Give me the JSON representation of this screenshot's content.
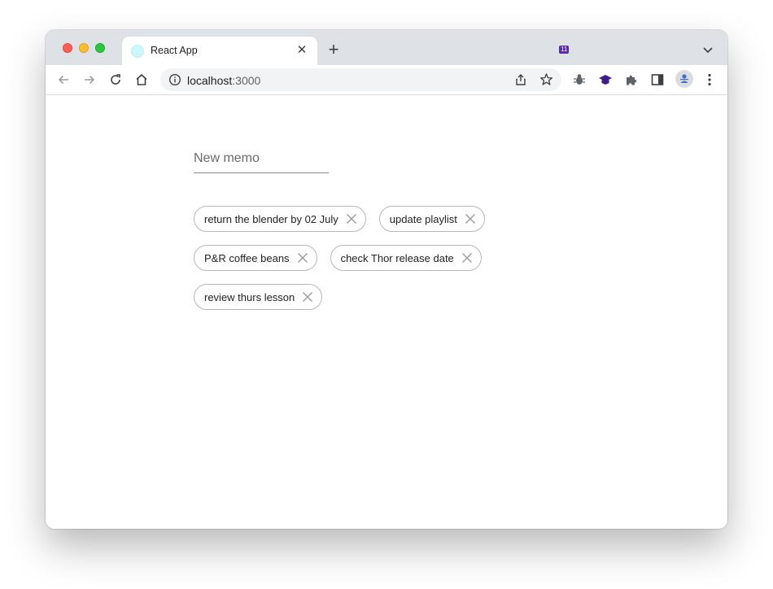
{
  "browser": {
    "tab_title": "React App",
    "url_host": "localhost",
    "url_port": ":3000",
    "extension_badge": "11"
  },
  "memo": {
    "input_placeholder": "New memo",
    "input_value": ""
  },
  "chips": [
    {
      "label": "return the blender by 02 July"
    },
    {
      "label": "update playlist"
    },
    {
      "label": "P&R coffee beans"
    },
    {
      "label": "check Thor release date"
    },
    {
      "label": "review thurs lesson"
    }
  ],
  "colors": {
    "tabstrip_bg": "#dee1e6",
    "chip_border": "#b8b8b8",
    "extension_badge_bg": "#5b2aa6"
  }
}
